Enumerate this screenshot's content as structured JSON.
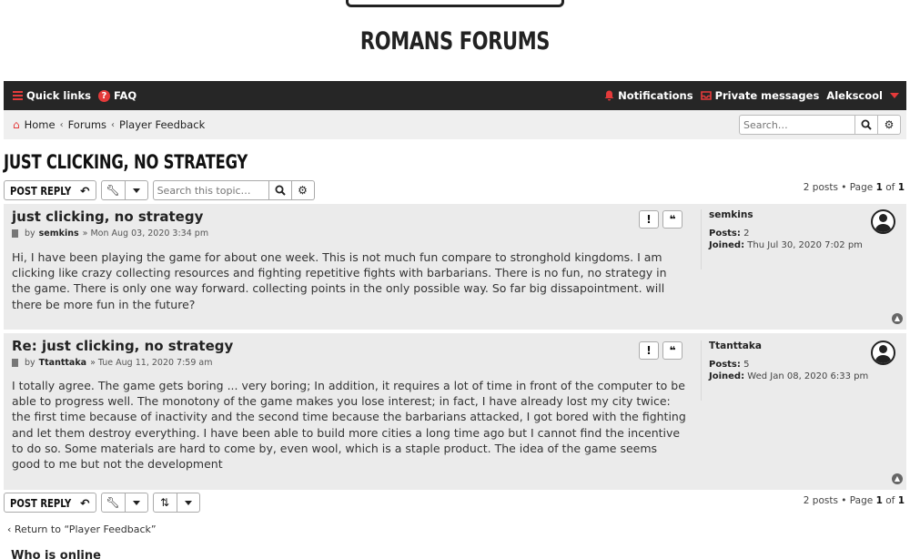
{
  "site": {
    "title": "ROMANS FORUMS"
  },
  "navbar": {
    "quick_links": "Quick links",
    "faq": "FAQ",
    "notifications": "Notifications",
    "private_messages": "Private messages",
    "username": "Alekscool"
  },
  "breadcrumb": {
    "home": "Home",
    "forums": "Forums",
    "current": "Player Feedback"
  },
  "header_search": {
    "placeholder": "Search…"
  },
  "topic": {
    "title": "JUST CLICKING, NO STRATEGY",
    "post_reply": "POST REPLY",
    "search_placeholder": "Search this topic…",
    "pagination_prefix": "2 posts • Page",
    "page_current": "1",
    "page_of": "of",
    "page_total": "1"
  },
  "posts": [
    {
      "title": "just clicking, no strategy",
      "by": "by",
      "author": "semkins",
      "date": "» Mon Aug 03, 2020 3:34 pm",
      "body": "Hi, I have been playing the game for about one week. This is not much fun compare to stronghold kingdoms. I am clicking like crazy collecting resources and fighting repetitive fights with barbarians. There is no fun, no strategy in the game. There is only one way forward. collecting points in the only possible way. So far big dissapointment. will there be more fun in the future?",
      "profile": {
        "username": "semkins",
        "posts_label": "Posts:",
        "posts": "2",
        "joined_label": "Joined:",
        "joined": "Thu Jul 30, 2020 7:02 pm"
      }
    },
    {
      "title": "Re: just clicking, no strategy",
      "by": "by",
      "author": "Ttanttaka",
      "date": "» Tue Aug 11, 2020 7:59 am",
      "body": "I totally agree. The game gets boring ... very boring; In addition, it requires a lot of time in front of the computer to be able to progress well. The monotony of the game makes you lose interest; in fact, I have already lost my city twice: the first time because of inactivity and the second time because the barbarians attacked, I got bored with the fighting and let them destroy everything. I have been able to build more cities a long time ago but I cannot find the incentive to do so. Some materials are hard to come by, even wool, which is a staple product. The idea of the game seems good to me but not the development",
      "profile": {
        "username": "Ttanttaka",
        "posts_label": "Posts:",
        "posts": "5",
        "joined_label": "Joined:",
        "joined": "Wed Jan 08, 2020 6:33 pm"
      }
    }
  ],
  "footer": {
    "return_link": "Return to “Player Feedback”",
    "who_is_online": "Who is online"
  },
  "icons": {
    "report": "!",
    "quote": "❝",
    "to_top": "▲"
  },
  "colors": {
    "accent": "#e43a3a",
    "navbar": "#262626",
    "post_bg": "#ebebeb"
  }
}
